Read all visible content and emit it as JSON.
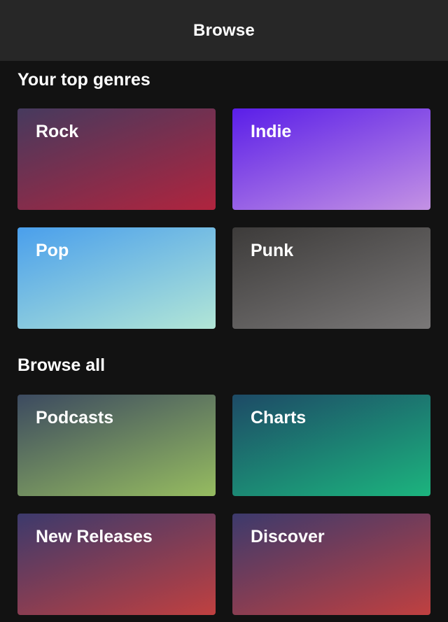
{
  "header": {
    "title": "Browse"
  },
  "sections": [
    {
      "title": "Your top genres",
      "tiles": [
        {
          "label": "Rock",
          "color_from": "#463a5e",
          "color_to": "#b0243e"
        },
        {
          "label": "Indie",
          "color_from": "#5a1ee8",
          "color_to": "#c492e4"
        },
        {
          "label": "Pop",
          "color_from": "#4a9fec",
          "color_to": "#b2e6d6"
        },
        {
          "label": "Punk",
          "color_from": "#3d3b3a",
          "color_to": "#7a7878"
        }
      ]
    },
    {
      "title": "Browse all",
      "tiles": [
        {
          "label": "Podcasts",
          "color_from": "#3c4a60",
          "color_to": "#96bc60"
        },
        {
          "label": "Charts",
          "color_from": "#1d4a66",
          "color_to": "#1cb47e"
        },
        {
          "label": "New Releases",
          "color_from": "#3c3a6c",
          "color_to": "#c04040"
        },
        {
          "label": "Discover",
          "color_from": "#3c3a6c",
          "color_to": "#c04040"
        }
      ]
    }
  ],
  "colors": {
    "background": "#121212",
    "header_background": "#272727",
    "text": "#ffffff"
  }
}
